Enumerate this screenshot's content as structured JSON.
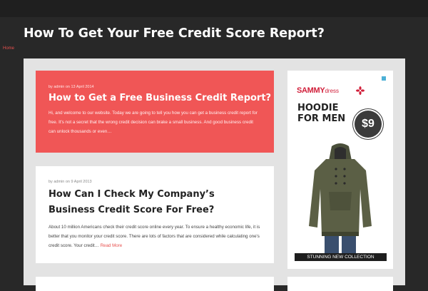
{
  "site": {
    "title": "How To Get Your Free Credit Score Report?"
  },
  "nav": {
    "home_label": "Home"
  },
  "posts": [
    {
      "meta": "by admin on 13 April 2014",
      "title": "How to Get a Free Business Credit Report?",
      "excerpt": "Hi, and welcome to our website. Today we are going to tell you how you can get a business credit report for free. It's not a secret that the wrong credit decision can brake a small business. And good business credit can unlock thousands or even…",
      "featured": true
    },
    {
      "meta": "by admin on 9 April 2013",
      "title": "How Can I Check My Company’s Business Credit Score For Free?",
      "excerpt": "About 10 million Americans check their credit score online every year. To ensure a healthy economic life, it is better that you monitor your credit score. There are lots of factors that are considered while calculating one's credit score. Your credit…",
      "read_more": "Read More",
      "featured": false
    }
  ],
  "ad": {
    "brand_primary": "SAMMY",
    "brand_secondary": "dress",
    "headline_line1": "HOODIE",
    "headline_line2": "FOR MEN",
    "price": "$9",
    "footer": "STUNNING NEW COLLECTION"
  },
  "colors": {
    "page_bg": "#282828",
    "accent": "#e8504e",
    "featured_bg": "#f05656",
    "content_bg": "#e3e3e3"
  },
  "icons": {
    "ad_close": "ad-choices-icon",
    "brand_mark": "flower-icon"
  }
}
